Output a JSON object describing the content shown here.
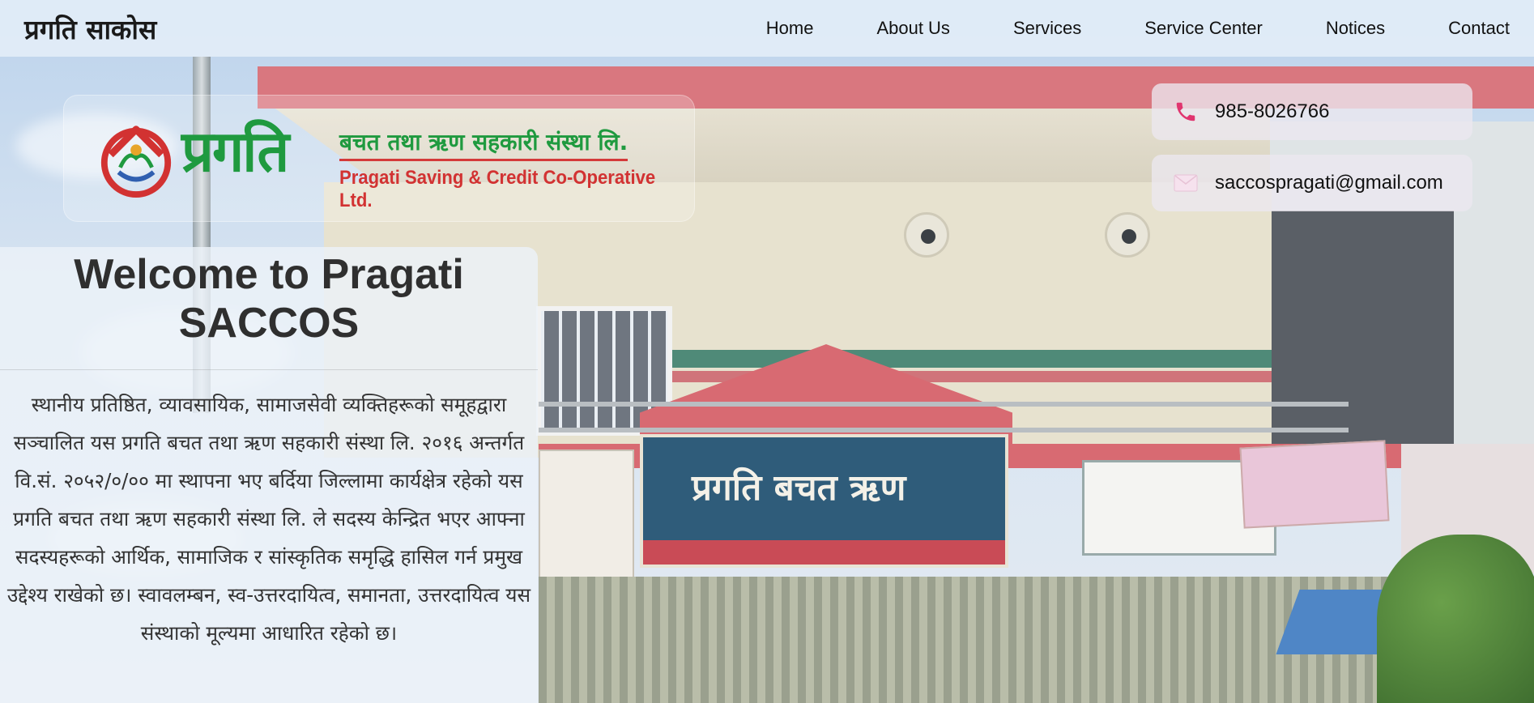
{
  "header": {
    "brand": "प्रगति साकोस",
    "nav": [
      {
        "label": "Home"
      },
      {
        "label": "About Us"
      },
      {
        "label": "Services"
      },
      {
        "label": "Service Center"
      },
      {
        "label": "Notices"
      },
      {
        "label": "Contact"
      }
    ]
  },
  "logo": {
    "main": "प्रगति",
    "sub_nepali": "बचत तथा ऋण सहकारी संस्था लि.",
    "sub_english": "Pragati Saving & Credit Co-Operative Ltd."
  },
  "contact": {
    "phone": "985-8026766",
    "email": "saccospragati@gmail.com",
    "phone_icon": "phone-icon",
    "email_icon": "envelope-icon"
  },
  "welcome": {
    "title": "Welcome to Pragati SACCOS",
    "body": "स्थानीय प्रतिष्ठित, व्यावसायिक, सामाजसेवी व्यक्तिहरूको समूहद्वारा सञ्चालित यस प्रगति बचत तथा ऋण सहकारी संस्था लि. २०१६ अन्तर्गत वि.सं. २०५२/०/०० मा स्थापना भए बर्दिया जिल्लामा कार्यक्षेत्र रहेको यस प्रगति बचत तथा ऋण सहकारी संस्था लि. ले सदस्य केन्द्रित भएर आफ्ना सदस्यहरूको आर्थिक, सामाजिक र सांस्कृतिक समृद्धि हासिल गर्न प्रमुख उद्देश्य राखेको छ। स्वावलम्बन, स्व-उत्तरदायित्व, समानता, उत्तरदायित्व यस संस्थाको मूल्यमा आधारित रहेको छ।"
  },
  "colors": {
    "brand_green": "#1f9a3f",
    "brand_red": "#d23232",
    "phone_icon": "#e0356f"
  }
}
